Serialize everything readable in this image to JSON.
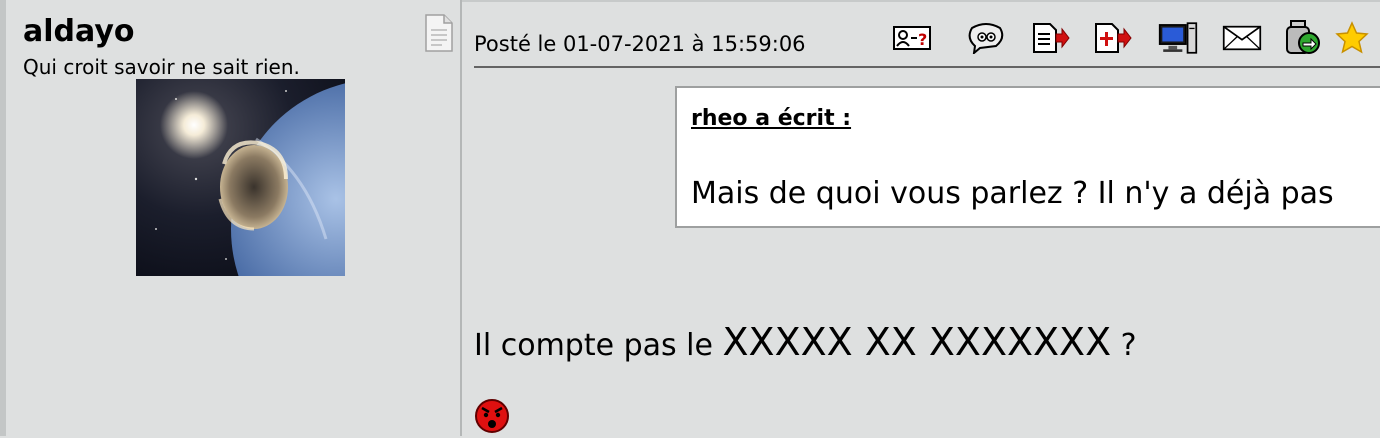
{
  "author": {
    "username": "aldayo",
    "title": "Qui croit savoir ne sait rien."
  },
  "post": {
    "posted_label": "Posté le 01-07-2021 à 15:59:06",
    "toolbar_icons": [
      "profile-card-icon",
      "quick-reply-icon",
      "quote-icon",
      "multi-quote-icon",
      "add-quote-icon",
      "website-icon",
      "mail-icon",
      "alert-icon",
      "favorite-star-icon"
    ],
    "quote": {
      "author": "rheo a écrit :",
      "text": "Mais de quoi vous parlez ? Il n'y a déjà pas"
    },
    "message_prefix": "Il compte pas le ",
    "message_censored": "XXXXX XX XXXXXXX",
    "message_suffix": " ?"
  },
  "colors": {
    "background": "#dee0e0",
    "quote_background": "#ffffff",
    "smiley_red": "#e01010"
  }
}
